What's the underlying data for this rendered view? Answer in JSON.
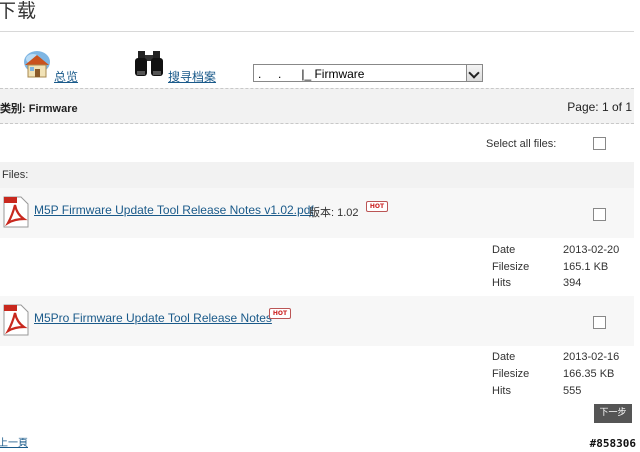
{
  "header": {
    "title": "下载"
  },
  "nav": {
    "overview_label": "总览",
    "search_label": "搜寻档案",
    "category_select_value": ".     .      |_ Firmware"
  },
  "category_bar": {
    "label": "类别: Firmware",
    "page_text": "Page: 1 of 1"
  },
  "select_all_label": "Select all files:",
  "files_header": "Files:",
  "files": [
    {
      "name": "M5P Firmware Update Tool Release Notes v1.02.pdf",
      "version": "版本: 1.02",
      "hot": "HOT",
      "date_label": "Date",
      "date": "2013-02-20",
      "size_label": "Filesize",
      "size": "165.1 KB",
      "hits_label": "Hits",
      "hits": "394"
    },
    {
      "name": "M5Pro Firmware Update Tool Release Notes",
      "version": "",
      "hot": "HOT",
      "date_label": "Date",
      "date": "2013-02-16",
      "size_label": "Filesize",
      "size": "166.35 KB",
      "hits_label": "Hits",
      "hits": "555"
    }
  ],
  "pagination": {
    "next_label": "下一步",
    "prev_label": "上一頁"
  },
  "watermark": "#858306",
  "colors": {
    "link": "#1a5a8a",
    "band": "#f2f2f2",
    "pdf_red": "#c8281e",
    "next_button": "#555555"
  }
}
